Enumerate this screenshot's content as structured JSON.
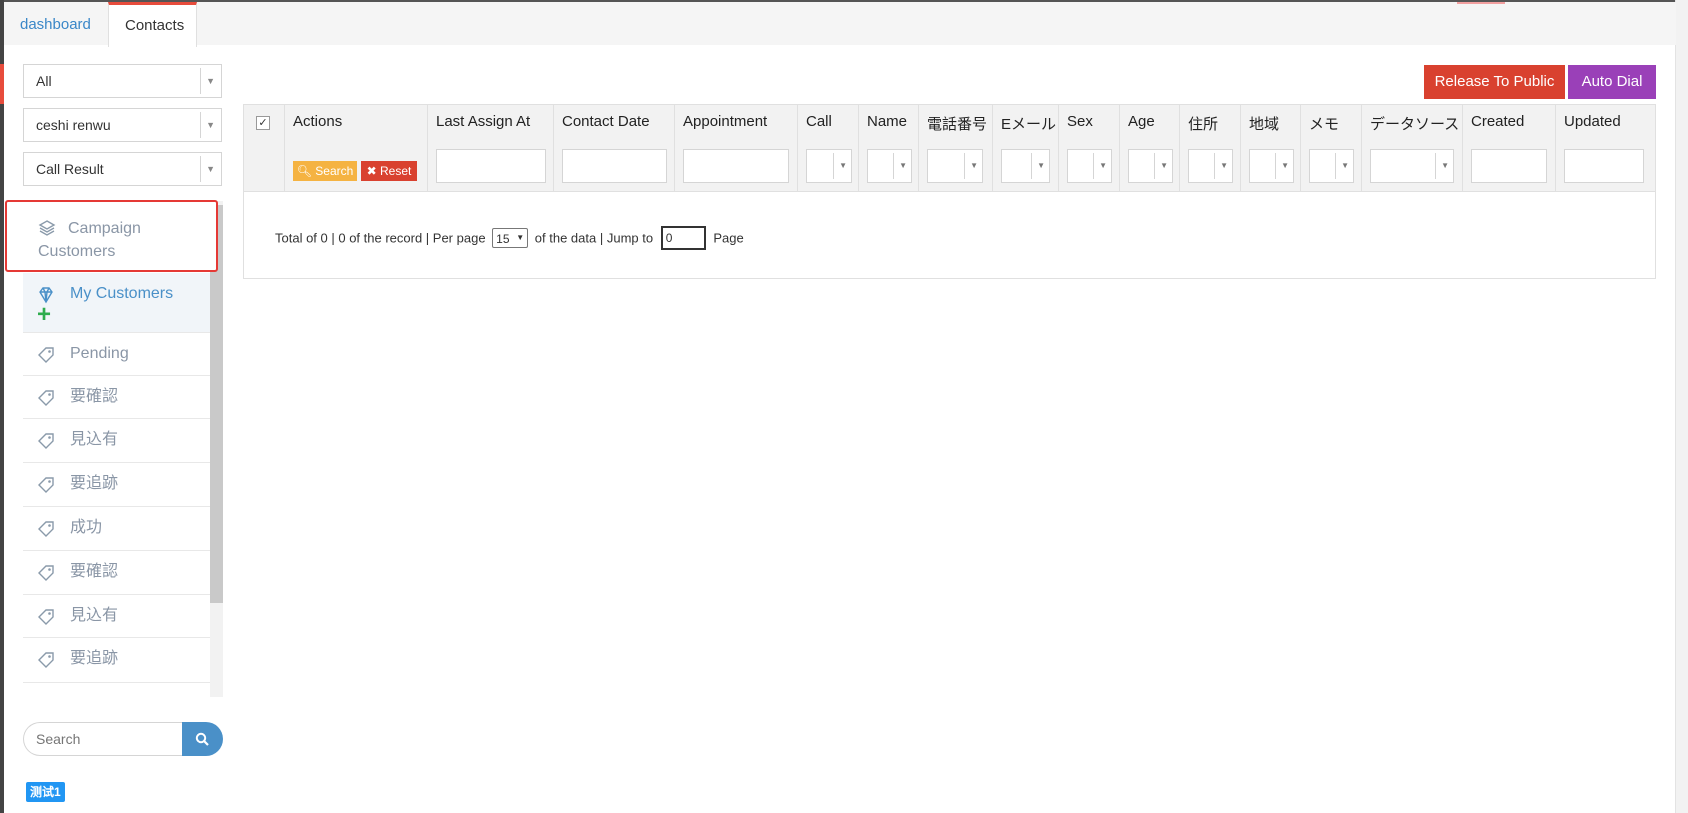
{
  "tabs": [
    {
      "label": "dashboard"
    },
    {
      "label": "Contacts"
    }
  ],
  "filters": {
    "scope": "All",
    "campaign": "ceshi renwu",
    "call_result": "Call Result"
  },
  "sidebar": {
    "items": [
      {
        "label": "Campaign Customers",
        "icon": "layers-icon"
      },
      {
        "label": "My Customers",
        "icon": "diamond-icon"
      },
      {
        "label": "Pending",
        "icon": "tag-icon"
      },
      {
        "label": "要確認",
        "icon": "tag-icon"
      },
      {
        "label": "見込有",
        "icon": "tag-icon"
      },
      {
        "label": "要追跡",
        "icon": "tag-icon"
      },
      {
        "label": "成功",
        "icon": "tag-icon"
      },
      {
        "label": "要確認",
        "icon": "tag-icon"
      },
      {
        "label": "見込有",
        "icon": "tag-icon"
      },
      {
        "label": "要追跡",
        "icon": "tag-icon"
      }
    ],
    "search_placeholder": "Search",
    "badge": "测试1"
  },
  "toolbar": {
    "release_label": "Release To Public",
    "autodial_label": "Auto Dial"
  },
  "table": {
    "columns": [
      "Actions",
      "Last Assign At",
      "Contact Date",
      "Appointment",
      "Call",
      "Name",
      "電話番号",
      "Eメール",
      "Sex",
      "Age",
      "住所",
      "地域",
      "メモ",
      "データソース",
      "Created",
      "Updated"
    ],
    "search_label": "Search",
    "reset_label": "Reset"
  },
  "pager": {
    "summary": "Total of 0 | 0 of the record | Per page",
    "per_page": "15",
    "of_data": "of the data | Jump to",
    "jump_value": "0",
    "page_label": "Page"
  },
  "colors": {
    "accent_blue": "#4a90c8",
    "release_red": "#d9412f",
    "autodial_purple": "#9a40b8",
    "search_orange": "#f5b342",
    "highlight_red": "#e53935"
  }
}
